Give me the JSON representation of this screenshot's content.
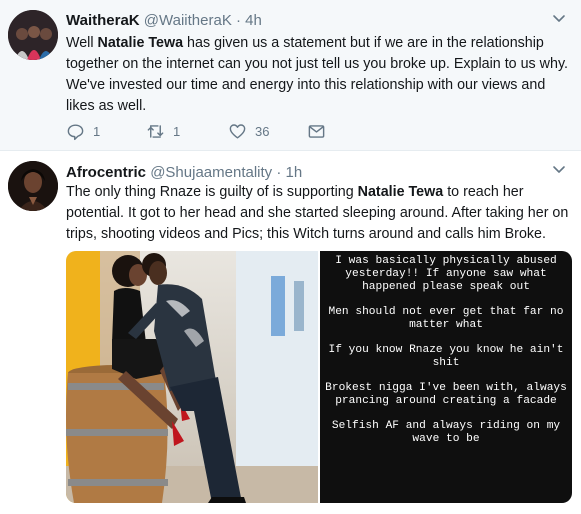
{
  "tweets": [
    {
      "name": "WaitheraK",
      "handle": "@WaiitheraK",
      "time": "4h",
      "text_parts": [
        "Well ",
        "Natalie Tewa",
        " has given us a statement but if we are in the relationship together on the internet can you not just tell us you broke up. Explain to us why. We've invested our time and energy into this relationship with our views and likes as well."
      ],
      "reply_count": "1",
      "retweet_count": "1",
      "like_count": "36"
    },
    {
      "name": "Afrocentric",
      "handle": "@Shujaamentality",
      "time": "1h",
      "text_parts": [
        "The only thing Rnaze is guilty of is supporting ",
        "Natalie Tewa",
        " to reach her potential. It got to her head and she started sleeping around. After taking her on trips, shooting videos and Pics; this Witch turns around and calls him Broke."
      ],
      "story_lines": [
        "I was basically physically abused yesterday!! If anyone saw what happened please speak out",
        "Men should not ever get that far no matter what",
        "If you know Rnaze you know he ain't shit",
        "Brokest nigga I've been with, always prancing around creating a facade",
        "Selfish AF and always riding on my wave to be"
      ]
    }
  ],
  "colors": {
    "text": "#14171a",
    "muted": "#657786",
    "highlight_bg": "#f5f8fa"
  },
  "icons": [
    "caret-down-icon",
    "reply-icon",
    "retweet-icon",
    "heart-icon",
    "direct-message-icon"
  ]
}
